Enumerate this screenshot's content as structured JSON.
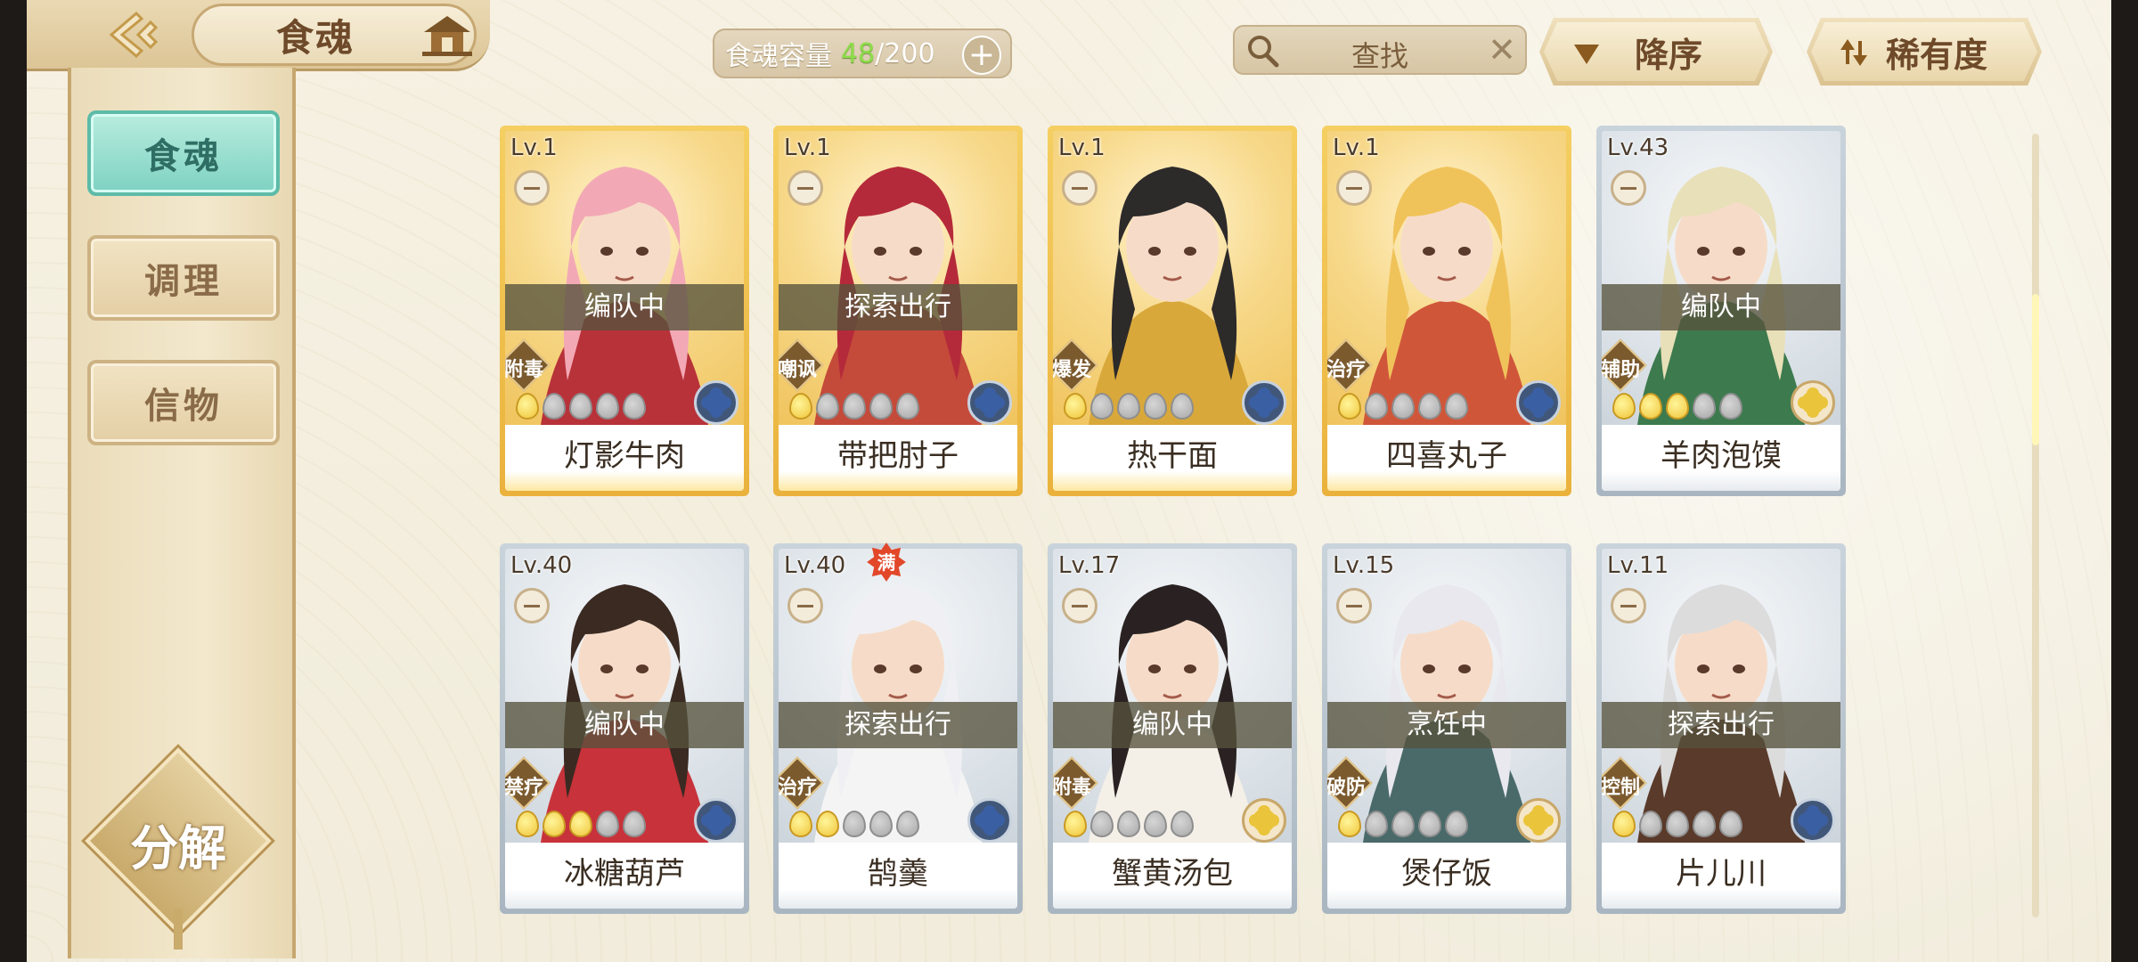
{
  "header": {
    "title": "食魂"
  },
  "capacity": {
    "label": "食魂容量",
    "current": "48",
    "max": "/200"
  },
  "search": {
    "placeholder": "查找"
  },
  "sort": {
    "order": "降序",
    "by": "稀有度"
  },
  "sidebar": {
    "items": [
      {
        "label": "食魂",
        "active": true
      },
      {
        "label": "调理"
      },
      {
        "label": "信物"
      }
    ],
    "decompose": "分解"
  },
  "cards": [
    {
      "level": "Lv.1",
      "status": "编队中",
      "role": "附毒",
      "name": "灯影牛肉",
      "stars": 1,
      "rarity": "gold",
      "attr": "blue"
    },
    {
      "level": "Lv.1",
      "status": "探索出行",
      "role": "嘲讽",
      "name": "带把肘子",
      "stars": 1,
      "rarity": "gold",
      "attr": "blue"
    },
    {
      "level": "Lv.1",
      "status": "",
      "role": "爆发",
      "name": "热干面",
      "stars": 1,
      "rarity": "gold",
      "attr": "blue"
    },
    {
      "level": "Lv.1",
      "status": "",
      "role": "治疗",
      "name": "四喜丸子",
      "stars": 1,
      "rarity": "gold",
      "attr": "blue"
    },
    {
      "level": "Lv.43",
      "status": "编队中",
      "role": "辅助",
      "name": "羊肉泡馍",
      "stars": 3,
      "rarity": "silver",
      "attr": "yellow"
    },
    {
      "level": "Lv.40",
      "status": "编队中",
      "role": "禁疗",
      "name": "冰糖葫芦",
      "stars": 3,
      "rarity": "silver",
      "attr": "blue"
    },
    {
      "level": "Lv.40",
      "status": "探索出行",
      "role": "治疗",
      "name": "鹄羹",
      "stars": 2,
      "rarity": "silver",
      "attr": "blue",
      "badge": "满"
    },
    {
      "level": "Lv.17",
      "status": "编队中",
      "role": "附毒",
      "name": "蟹黄汤包",
      "stars": 1,
      "rarity": "silver",
      "attr": "yellow"
    },
    {
      "level": "Lv.15",
      "status": "烹饪中",
      "role": "破防",
      "name": "煲仔饭",
      "stars": 1,
      "rarity": "silver",
      "attr": "yellow"
    },
    {
      "level": "Lv.11",
      "status": "探索出行",
      "role": "控制",
      "name": "片儿川",
      "stars": 1,
      "rarity": "silver",
      "attr": "blue"
    }
  ],
  "colors": {
    "accent_gold": "#eab23c",
    "tab_active": "#7ed2c2",
    "capacity_green": "#8ddd4a"
  }
}
